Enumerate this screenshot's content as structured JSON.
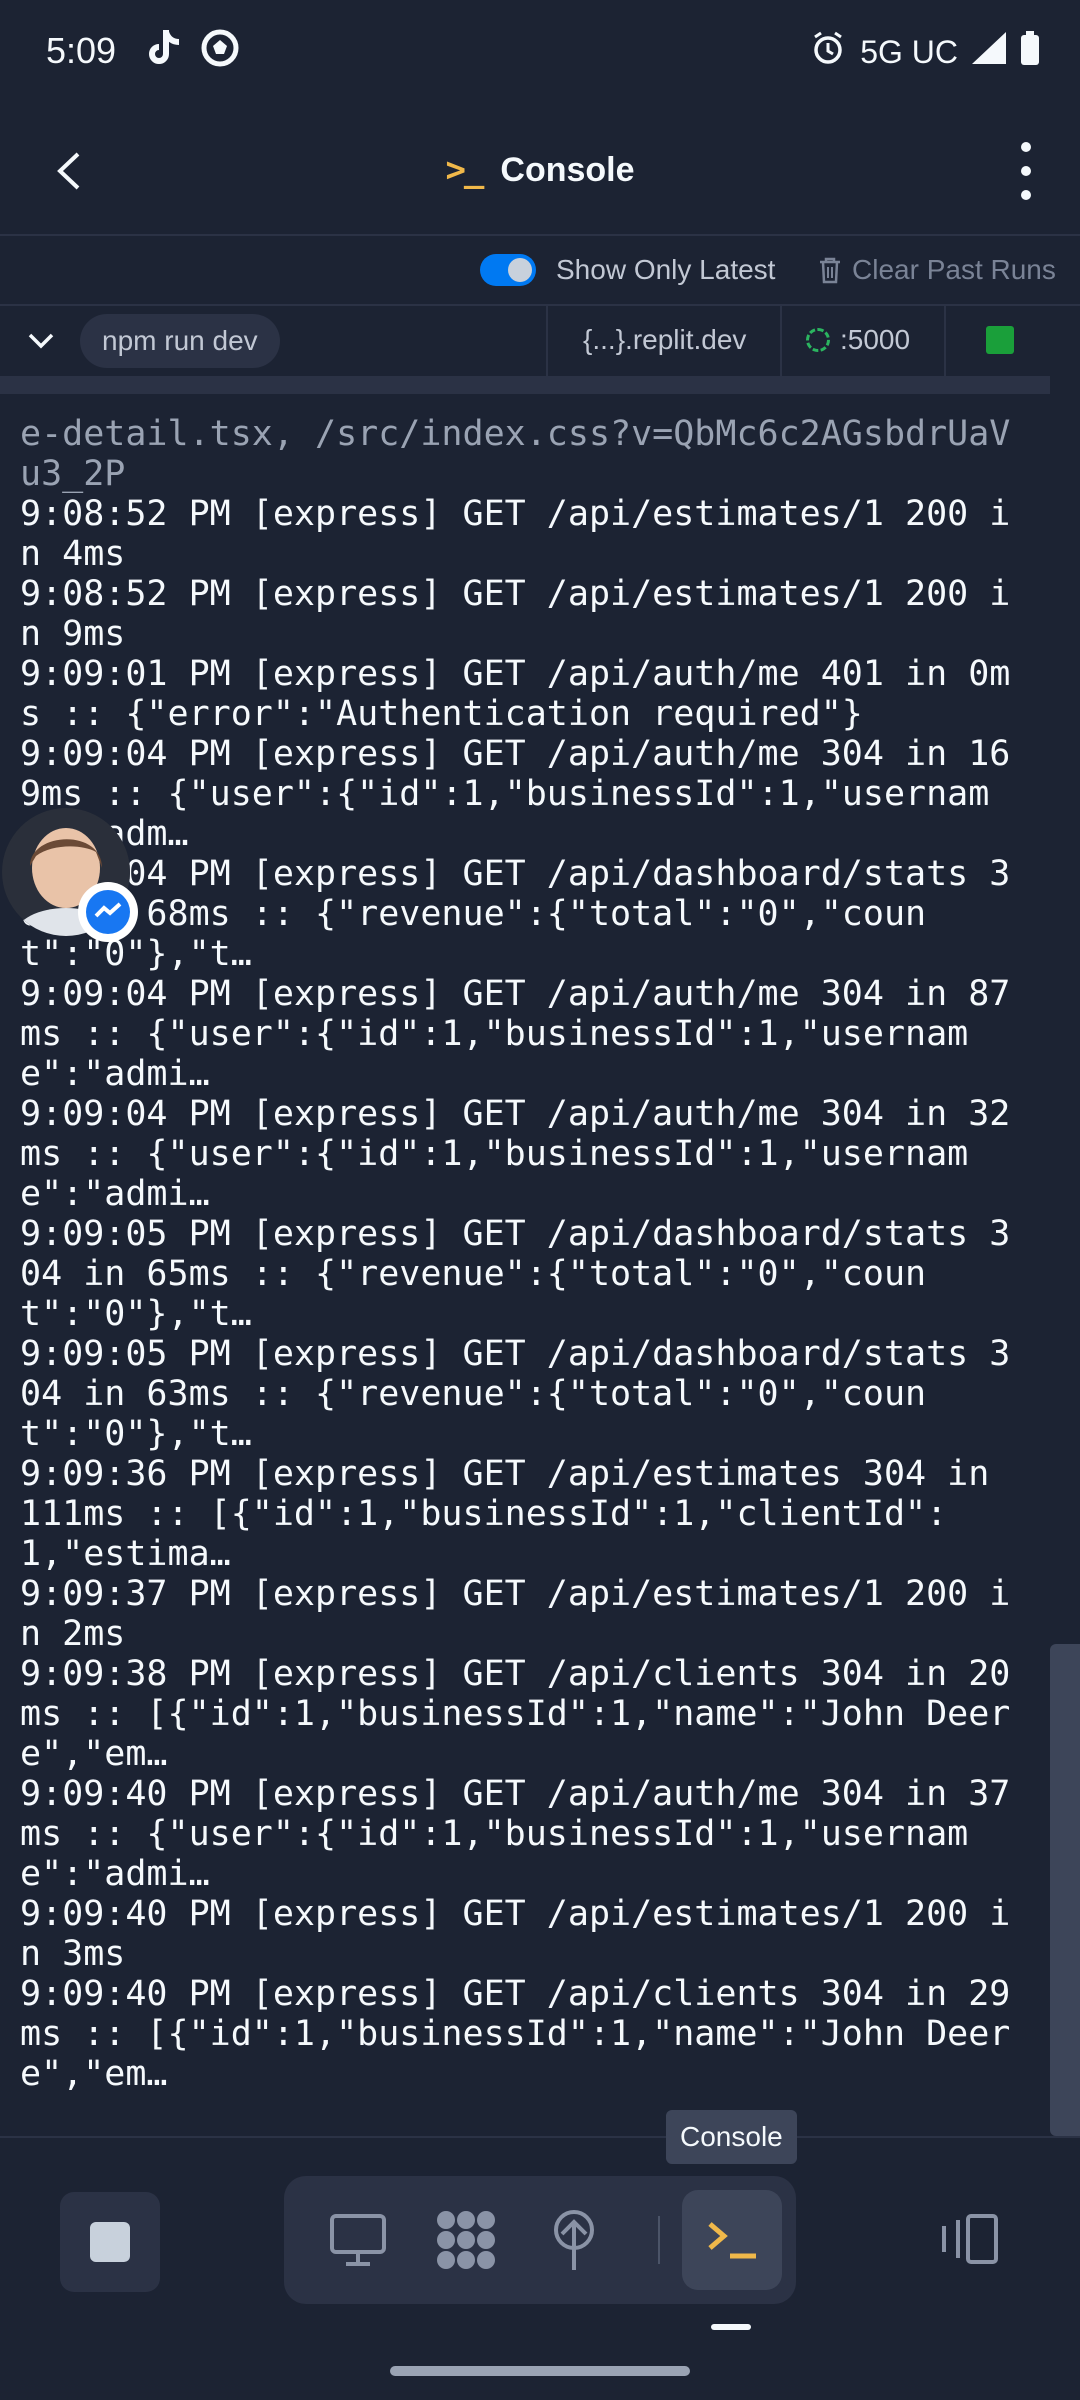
{
  "status_bar": {
    "time": "5:09",
    "network": "5G UC",
    "icons": [
      "tiktok-icon",
      "soccer-ball-icon",
      "alarm-icon",
      "signal-icon",
      "battery-icon"
    ]
  },
  "header": {
    "title": "Console",
    "title_icon": ">_"
  },
  "options": {
    "show_only_latest_label": "Show Only Latest",
    "show_only_latest_on": true,
    "clear_past_runs_label": "Clear Past Runs"
  },
  "run_bar": {
    "command": "npm run dev",
    "url": "{...}.replit.dev",
    "port": ":5000"
  },
  "log_lines": [
    "e-detail.tsx, /src/index.css?v=QbMc6c2AGsbdrUaVu3_2P",
    "9:08:52 PM [express] GET /api/estimates/1 200 in 4ms",
    "9:08:52 PM [express] GET /api/estimates/1 200 in 9ms",
    "9:09:01 PM [express] GET /api/auth/me 401 in 0ms :: {\"error\":\"Authentication required\"}",
    "9:09:04 PM [express] GET /api/auth/me 304 in 169ms :: {\"user\":{\"id\":1,\"businessId\":1,\"username\":\"adm…",
    "9:09:04 PM [express] GET /api/dashboard/stats 304 in 68ms :: {\"revenue\":{\"total\":\"0\",\"count\":\"0\"},\"t…",
    "9:09:04 PM [express] GET /api/auth/me 304 in 87ms :: {\"user\":{\"id\":1,\"businessId\":1,\"username\":\"admi…",
    "9:09:04 PM [express] GET /api/auth/me 304 in 32ms :: {\"user\":{\"id\":1,\"businessId\":1,\"username\":\"admi…",
    "9:09:05 PM [express] GET /api/dashboard/stats 304 in 65ms :: {\"revenue\":{\"total\":\"0\",\"count\":\"0\"},\"t…",
    "9:09:05 PM [express] GET /api/dashboard/stats 304 in 63ms :: {\"revenue\":{\"total\":\"0\",\"count\":\"0\"},\"t…",
    "9:09:36 PM [express] GET /api/estimates 304 in 111ms :: [{\"id\":1,\"businessId\":1,\"clientId\":1,\"estima…",
    "9:09:37 PM [express] GET /api/estimates/1 200 in 2ms",
    "9:09:38 PM [express] GET /api/clients 304 in 20ms :: [{\"id\":1,\"businessId\":1,\"name\":\"John Deere\",\"em…",
    "9:09:40 PM [express] GET /api/auth/me 304 in 37ms :: {\"user\":{\"id\":1,\"businessId\":1,\"username\":\"admi…",
    "9:09:40 PM [express] GET /api/estimates/1 200 in 3ms",
    "9:09:40 PM [express] GET /api/clients 304 in 29ms :: [{\"id\":1,\"businessId\":1,\"name\":\"John Deere\",\"em…"
  ],
  "tooltip": "Console",
  "bottom_nav": {
    "tools": [
      "webview-icon",
      "workspace-icon",
      "deploy-icon",
      "console-icon"
    ],
    "active": "console-icon"
  },
  "colors": {
    "background": "#1c2333",
    "surface": "#2b3245",
    "accent_blue": "#0079f2",
    "console_icon": "#f0b84a",
    "running_green": "#1a9f3a"
  }
}
